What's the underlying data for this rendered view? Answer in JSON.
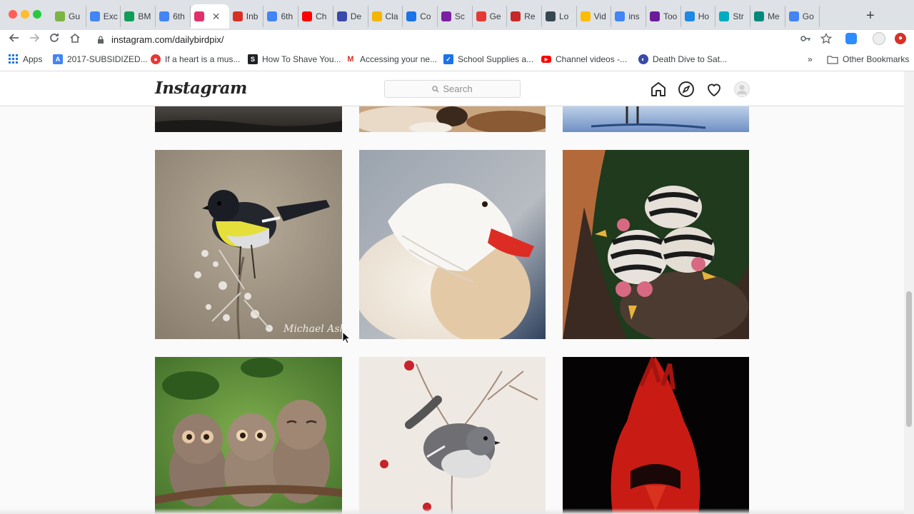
{
  "browser": {
    "tabs": [
      {
        "label": "Gu",
        "icon": "gutenberg-icon",
        "color": "#7cb342"
      },
      {
        "label": "Exc",
        "icon": "docs-icon",
        "color": "#4285f4"
      },
      {
        "label": "BM",
        "icon": "sheets-icon",
        "color": "#0f9d58"
      },
      {
        "label": "6th",
        "icon": "docs-icon",
        "color": "#4285f4"
      },
      {
        "label": "",
        "icon": "instagram-icon",
        "color": "#e1306c",
        "active": true
      },
      {
        "label": "Inb",
        "icon": "gmail-icon",
        "color": "#d93025"
      },
      {
        "label": "6th",
        "icon": "docs-icon",
        "color": "#4285f4"
      },
      {
        "label": "Ch",
        "icon": "youtube-icon",
        "color": "#ff0000"
      },
      {
        "label": "De",
        "icon": "circle-icon",
        "color": "#3949ab"
      },
      {
        "label": "Cla",
        "icon": "classroom-icon",
        "color": "#f4b400"
      },
      {
        "label": "Co",
        "icon": "contacts-icon",
        "color": "#1a73e8"
      },
      {
        "label": "Sc",
        "icon": "site-icon",
        "color": "#7b1fa2"
      },
      {
        "label": "Ge",
        "icon": "get-icon",
        "color": "#e53935"
      },
      {
        "label": "Re",
        "icon": "re-icon",
        "color": "#c62828"
      },
      {
        "label": "Lo",
        "icon": "lo-icon",
        "color": "#37474f"
      },
      {
        "label": "Vid",
        "icon": "drive-icon",
        "color": "#fbbc04"
      },
      {
        "label": "ins",
        "icon": "google-icon",
        "color": "#4285f4"
      },
      {
        "label": "Too",
        "icon": "tool-icon",
        "color": "#6a1b9a"
      },
      {
        "label": "Ho",
        "icon": "ho-icon",
        "color": "#1e88e5"
      },
      {
        "label": "Str",
        "icon": "play-icon",
        "color": "#00acc1"
      },
      {
        "label": "Me",
        "icon": "meet-icon",
        "color": "#00897b"
      },
      {
        "label": "Go",
        "icon": "google-icon",
        "color": "#4285f4"
      }
    ],
    "active_close": "✕",
    "new_tab": "+",
    "url": "instagram.com/dailybirdpix/",
    "bookmarks": [
      {
        "label": "Apps",
        "icon": "apps-grid-icon"
      },
      {
        "label": "2017-SUBSIDIZED...",
        "icon": "bookmark-a-icon",
        "color": "#4285f4"
      },
      {
        "label": "If a heart is a mus...",
        "icon": "bookmark-b-icon",
        "color": "#e53935"
      },
      {
        "label": "How To Shave You...",
        "icon": "bookmark-s-icon",
        "color": "#202124"
      },
      {
        "label": "Accessing your ne...",
        "icon": "gmail-icon",
        "color": "#d93025"
      },
      {
        "label": "School Supplies a...",
        "icon": "bookmark-check-icon",
        "color": "#1a73e8"
      },
      {
        "label": "Channel videos -...",
        "icon": "youtube-icon",
        "color": "#ff0000"
      },
      {
        "label": "Death Dive to Sat...",
        "icon": "bookmark-circle-icon",
        "color": "#3949ab"
      }
    ],
    "more": "»",
    "other_bookmarks": "Other Bookmarks"
  },
  "instagram": {
    "logo": "Instagram",
    "search_placeholder": "Search",
    "nav": [
      "home-icon",
      "explore-icon",
      "activity-heart-icon",
      "profile-avatar"
    ]
  },
  "photos": [
    {
      "name": "photo-top-left",
      "subject": "partial dark photo"
    },
    {
      "name": "photo-top-middle",
      "subject": "partial bird photo"
    },
    {
      "name": "photo-top-right",
      "subject": "partial water photo"
    },
    {
      "name": "photo-tomtit",
      "subject": "black and yellow tomtit on a branch"
    },
    {
      "name": "photo-white-duck",
      "subject": "white mandarin duck"
    },
    {
      "name": "photo-chicks",
      "subject": "striped grebe chicks"
    },
    {
      "name": "photo-owls",
      "subject": "three owlets on a branch"
    },
    {
      "name": "photo-robin",
      "subject": "grey bird on a branch"
    },
    {
      "name": "photo-cardinal",
      "subject": "red cardinal"
    }
  ],
  "colors": {
    "accent": "#e1306c"
  }
}
